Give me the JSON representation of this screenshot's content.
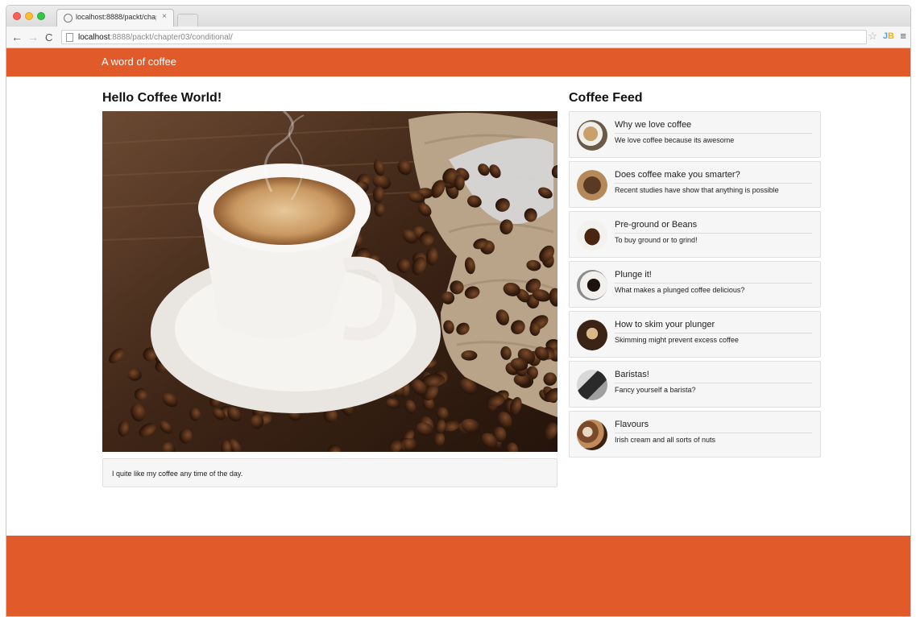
{
  "browser": {
    "tab_title": "localhost:8888/packt/chap",
    "tab_close": "×",
    "url_host": "localhost",
    "url_rest": ":8888/packt/chapter03/conditional/"
  },
  "navbar": {
    "brand": "A word of coffee"
  },
  "main": {
    "heading": "Hello Coffee World!",
    "caption": "I quite like my coffee any time of the day."
  },
  "feed": {
    "heading": "Coffee Feed",
    "items": [
      {
        "title": "Why we love coffee",
        "desc": "We love coffee because its awesome"
      },
      {
        "title": "Does coffee make you smarter?",
        "desc": "Recent studies have show that anything is possible"
      },
      {
        "title": "Pre-ground or Beans",
        "desc": "To buy ground or to grind!"
      },
      {
        "title": "Plunge it!",
        "desc": "What makes a plunged coffee delicious?"
      },
      {
        "title": "How to skim your plunger",
        "desc": "Skimming might prevent excess coffee"
      },
      {
        "title": "Baristas!",
        "desc": "Fancy yourself a barista?"
      },
      {
        "title": "Flavours",
        "desc": "Irish cream and all sorts of nuts"
      }
    ]
  },
  "colors": {
    "accent": "#e05a2a"
  }
}
